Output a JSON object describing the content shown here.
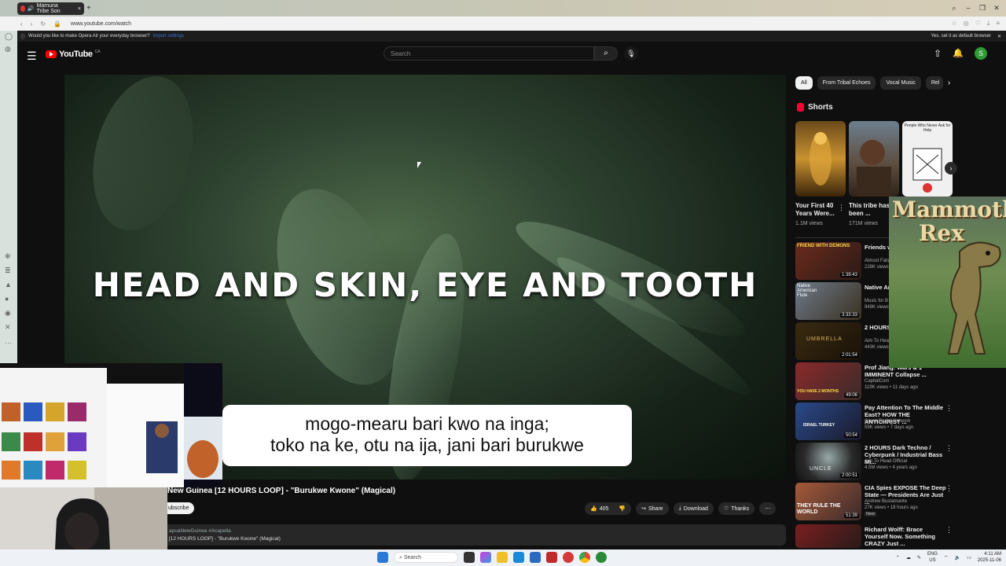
{
  "browser": {
    "tab_title": "Mamuna Tribe Son",
    "url": "www.youtube.com/watch",
    "info_prompt": "Would you like to make Opera Air your everyday browser?",
    "info_link": "Import settings",
    "info_right": "Yes, set it as default browser"
  },
  "youtube": {
    "logo_text": "YouTube",
    "country": "CA",
    "search_placeholder": "Search",
    "avatar_letter": "S"
  },
  "video": {
    "lyric_line": "HEAD AND SKIN, EYE AND TOOTH",
    "subtitle_line1": "mogo-mearu bari kwo na inga;",
    "subtitle_line2": "toko na ke, otu na ija, jani bari burukwe",
    "title": "New Guinea [12 HOURS LOOP] - \"Burukwe Kwone\" (Magical)",
    "subscribe_label": "ubscribe",
    "likes": "405",
    "share_label": "Share",
    "download_label": "Download",
    "thanks_label": "Thanks",
    "desc_tags": "apuaNewGuinea #Acapella",
    "desc_line": "[12 HOURS LOOP] - \"Burukwe Kwone\" (Magical)"
  },
  "chips": [
    "All",
    "From Tribal Echoes",
    "Vocal Music",
    "Rel"
  ],
  "shorts": {
    "label": "Shorts",
    "items": [
      {
        "title": "Your First 40 Years Were...",
        "views": "1.1M views"
      },
      {
        "title": "This tribe has been ...",
        "views": "171M views"
      },
      {
        "title": "People Who Never Ask for Help",
        "views": ""
      }
    ]
  },
  "recs": [
    {
      "title": "Friends wi Atheist Wi",
      "channel": "Almost Fals",
      "meta": "228K views",
      "duration": "1:39:43",
      "thumb_text": "FRIEND WITH DEMONS"
    },
    {
      "title": "Native Am Remove A",
      "channel": "Music for B",
      "meta": "949K views",
      "duration": "3:33:33",
      "thumb_text": "Native American Flute"
    },
    {
      "title": "2 HOURS / Industri",
      "channel": "Aim To Hea",
      "meta": "443K views",
      "duration": "2:01:54",
      "thumb_text": "UMBRELLA"
    },
    {
      "title": "Prof Jiang: Wars & 1 IMMINENT Collapse ...",
      "channel": "CapitalCom",
      "meta": "119K views • 11 days ago",
      "duration": "49:06",
      "thumb_text": "YOU HAVE 2 MONTHS"
    },
    {
      "title": "Pay Attention To The Middle East? HOW THE ANTICHRIST ...",
      "channel": "Grace Digital Network",
      "meta": "59K views • 7 days ago",
      "duration": "50:54",
      "thumb_text": "ISRAEL TURKEY"
    },
    {
      "title": "2 HOURS Dark Techno / Cyberpunk / Industrial Bass Mi...",
      "channel": "Aim To Head Official",
      "meta": "4.5M views • 4 years ago",
      "duration": "2:00:51",
      "thumb_text": "UNCLE"
    },
    {
      "title": "CIA Spies EXPOSE The Deep State — Presidents Are Just ...",
      "channel": "Andrew Bustamante",
      "meta": "27K views • 18 hours ago",
      "duration": "51:39",
      "thumb_text": "THEY RULE THE WORLD",
      "badge": "New"
    },
    {
      "title": "Richard Wolff: Brace Yourself Now. Something CRAZY Just ...",
      "channel": "",
      "meta": "",
      "duration": "",
      "thumb_text": ""
    }
  ],
  "overlay": {
    "mammoth_line1": "Mammoth",
    "mammoth_line2": "Rex"
  },
  "taskbar": {
    "search": "Search",
    "lang": "ENG",
    "region": "US",
    "time": "4:11 AM",
    "date": "2025-11-06"
  },
  "colors": {
    "yt_red": "#ff0000",
    "bg": "#0f0f0f",
    "avatar_green": "#2e9b36"
  }
}
